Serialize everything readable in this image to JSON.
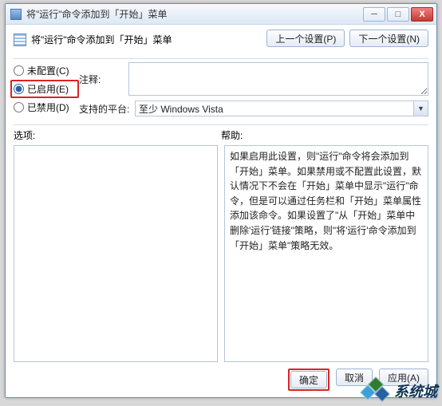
{
  "window": {
    "title": "将\"运行\"命令添加到「开始」菜单",
    "heading": "将\"运行\"命令添加到「开始」菜单"
  },
  "nav": {
    "prev": "上一个设置(P)",
    "next": "下一个设置(N)"
  },
  "radio": {
    "not_configured": "未配置(C)",
    "enabled": "已启用(E)",
    "disabled": "已禁用(D)",
    "selected": "enabled"
  },
  "fields": {
    "comment_label": "注释:",
    "comment_value": "",
    "platform_label": "支持的平台:",
    "platform_value": "至少 Windows Vista"
  },
  "sections": {
    "options": "选项:",
    "help": "帮助:"
  },
  "options_text": "",
  "help_text": "如果启用此设置，则\"运行\"命令将会添加到「开始」菜单。如果禁用或不配置此设置，默认情况下不会在「开始」菜单中显示\"运行\"命令，但是可以通过任务栏和「开始」菜单属性添加该命令。如果设置了\"从「开始」菜单中删除'运行'链接\"策略，则\"将'运行'命令添加到「开始」菜单\"策略无效。",
  "footer": {
    "ok": "确定",
    "cancel": "取消",
    "apply": "应用(A)"
  },
  "watermark": "系统城",
  "winbtns": {
    "min": "─",
    "max": "□",
    "close": "X"
  }
}
